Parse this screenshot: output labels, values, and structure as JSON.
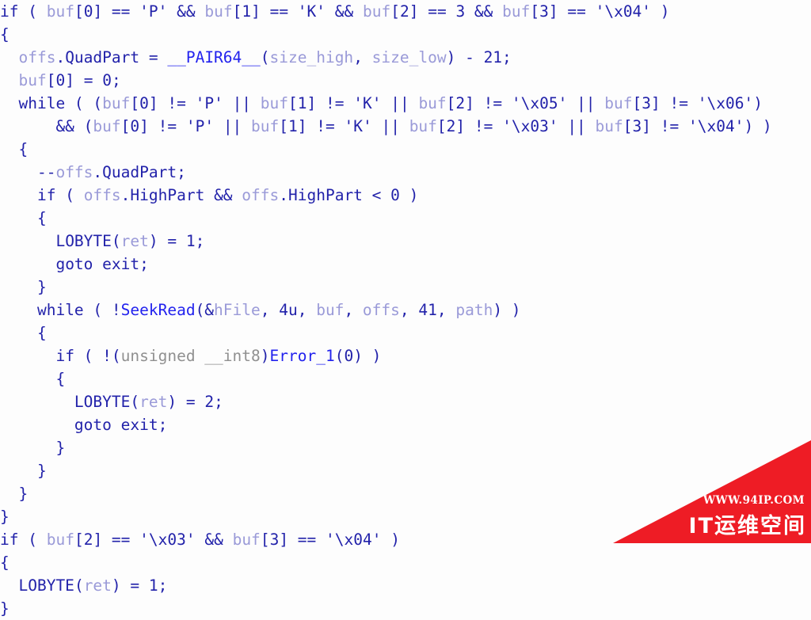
{
  "view": {
    "title": "Decompiler pseudocode listing",
    "background_color": "#fdfdfd",
    "font_size_px": 19.5,
    "line_height_px": 29,
    "line_count": 26
  },
  "colors": {
    "keyword": "#2222aa",
    "variable": "#9a9ad8",
    "function": "#2222ee",
    "type": "#909090",
    "background": "#fdfdfd",
    "watermark_red": "#ee1c25",
    "watermark_text": "#ffffff"
  },
  "code": {
    "lines": [
      "if ( buf[0] == 'P' && buf[1] == 'K' && buf[2] == 3 && buf[3] == '\\x04' )",
      "{",
      "  offs.QuadPart = __PAIR64__(size_high, size_low) - 21;",
      "  buf[0] = 0;",
      "  while ( (buf[0] != 'P' || buf[1] != 'K' || buf[2] != '\\x05' || buf[3] != '\\x06')",
      "       && (buf[0] != 'P' || buf[1] != 'K' || buf[2] != '\\x03' || buf[3] != '\\x04') )",
      "  {",
      "    --offs.QuadPart;",
      "    if ( offs.HighPart && offs.HighPart < 0 )",
      "    {",
      "      LOBYTE(ret) = 1;",
      "      goto exit;",
      "    }",
      "    while ( !SeekRead(&hFile, 4u, buf, offs, 41, path) )",
      "    {",
      "      if ( !(unsigned __int8)Error_1(0) )",
      "      {",
      "        LOBYTE(ret) = 2;",
      "        goto exit;",
      "      }",
      "    }",
      "  }",
      "}",
      "if ( buf[2] == '\\x03' && buf[3] == '\\x04' )",
      "{",
      "  LOBYTE(ret) = 1;",
      "}"
    ],
    "identifiers": {
      "variables": [
        "buf",
        "offs",
        "size_high",
        "size_low",
        "ret",
        "hFile",
        "path"
      ],
      "functions": [
        "__PAIR64__",
        "SeekRead",
        "Error_1"
      ],
      "macros": [
        "LOBYTE"
      ],
      "members": [
        "QuadPart",
        "HighPart"
      ],
      "keywords": [
        "if",
        "while",
        "goto"
      ],
      "types": [
        "unsigned __int8"
      ],
      "labels": [
        "exit"
      ],
      "literals": [
        "'P'",
        "'K'",
        "3",
        "'\\x04'",
        "'\\x05'",
        "'\\x06'",
        "'\\x03'",
        "0",
        "1",
        "2",
        "21",
        "4u",
        "41"
      ]
    }
  },
  "watermark": {
    "url": "WWW.94IP.COM",
    "site_name": "IT运维空间",
    "shape": "corner-triangle"
  }
}
